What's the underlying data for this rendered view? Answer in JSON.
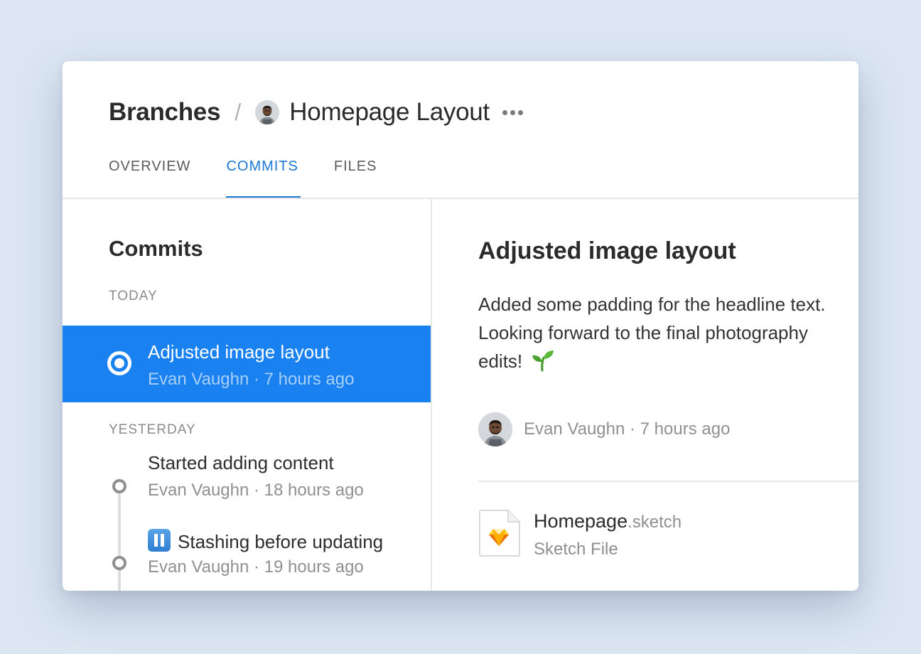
{
  "header": {
    "breadcrumb_root": "Branches",
    "breadcrumb_separator": "/",
    "branch_title": "Homepage Layout"
  },
  "tabs": [
    {
      "label": "OVERVIEW",
      "active": false
    },
    {
      "label": "COMMITS",
      "active": true
    },
    {
      "label": "FILES",
      "active": false
    }
  ],
  "commits_panel": {
    "title": "Commits",
    "groups": [
      {
        "label": "TODAY",
        "items": [
          {
            "title": "Adjusted image layout",
            "author": "Evan Vaughn",
            "time": "7 hours ago",
            "meta": "Evan Vaughn · 7 hours ago",
            "selected": true
          }
        ]
      },
      {
        "label": "YESTERDAY",
        "items": [
          {
            "title": "Started adding content",
            "author": "Evan Vaughn",
            "time": "18 hours ago",
            "meta": "Evan Vaughn · 18 hours ago",
            "selected": false
          },
          {
            "title": "Stashing before updating",
            "icon": "pause-button-emoji",
            "author": "Evan Vaughn",
            "time": "19 hours ago",
            "meta": "Evan Vaughn · 19 hours ago",
            "selected": false
          }
        ]
      }
    ]
  },
  "detail": {
    "title": "Adjusted image layout",
    "description": "Added some padding for the headline text. Looking forward to the final photography edits!",
    "description_icon": "seedling-emoji",
    "author_meta": "Evan Vaughn · 7 hours ago",
    "file": {
      "name": "Homepage",
      "extension": ".sketch",
      "type": "Sketch File",
      "icon": "sketch-file-icon"
    }
  },
  "colors": {
    "accent": "#1b78d4",
    "selection": "#1a81f1",
    "background": "#dce6f3"
  }
}
